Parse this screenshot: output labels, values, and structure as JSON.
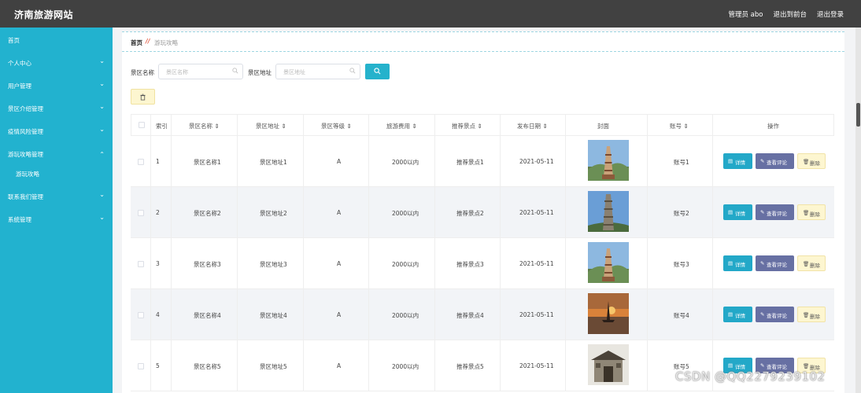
{
  "app": {
    "title": "济南旅游网站",
    "user_label": "管理员 abo",
    "front_link": "退出到前台",
    "logout": "退出登录"
  },
  "sidebar": {
    "items": [
      {
        "label": "首页",
        "chevron": ""
      },
      {
        "label": "个人中心",
        "chevron": "down"
      },
      {
        "label": "用户管理",
        "chevron": "down"
      },
      {
        "label": "景区介绍管理",
        "chevron": "down"
      },
      {
        "label": "疫情风险管理",
        "chevron": "down"
      },
      {
        "label": "游玩攻略管理",
        "chevron": "up"
      },
      {
        "label": "游玩攻略",
        "chevron": "",
        "sub": true
      },
      {
        "label": "联系我们管理",
        "chevron": "down"
      },
      {
        "label": "系统管理",
        "chevron": "down"
      }
    ]
  },
  "breadcrumb": {
    "home": "首页",
    "separator": "//",
    "current": "游玩攻略"
  },
  "filters": {
    "name_label": "景区名称",
    "name_placeholder": "景区名称",
    "address_label": "景区地址",
    "address_placeholder": "景区地址"
  },
  "table": {
    "columns": [
      "索引",
      "景区名称",
      "景区地址",
      "景区等级",
      "旅游费用",
      "推荐景点",
      "发布日期",
      "封面",
      "账号",
      "操作"
    ],
    "rows": [
      {
        "index": "1",
        "name": "景区名称1",
        "address": "景区地址1",
        "level": "A",
        "cost": "2000以内",
        "spot": "推荐景点1",
        "date": "2021-05-11",
        "cover": "pagoda",
        "account": "账号1"
      },
      {
        "index": "2",
        "name": "景区名称2",
        "address": "景区地址2",
        "level": "A",
        "cost": "2000以内",
        "spot": "推荐景点2",
        "date": "2021-05-11",
        "cover": "tower",
        "account": "账号2"
      },
      {
        "index": "3",
        "name": "景区名称3",
        "address": "景区地址3",
        "level": "A",
        "cost": "2000以内",
        "spot": "推荐景点3",
        "date": "2021-05-11",
        "cover": "pagoda",
        "account": "账号3"
      },
      {
        "index": "4",
        "name": "景区名称4",
        "address": "景区地址4",
        "level": "A",
        "cost": "2000以内",
        "spot": "推荐景点4",
        "date": "2021-05-11",
        "cover": "sailboat",
        "account": "账号4"
      },
      {
        "index": "5",
        "name": "景区名称5",
        "address": "景区地址5",
        "level": "A",
        "cost": "2000以内",
        "spot": "推荐景点5",
        "date": "2021-05-11",
        "cover": "gate",
        "account": "账号5"
      }
    ],
    "actions": {
      "detail": "详情",
      "comment": "查看评论",
      "delete": "删除"
    }
  },
  "watermark": "CSDN @QQ2279239102",
  "colors": {
    "topbar": "#414141",
    "sidebar": "#22b2cf",
    "accent": "#25b2cc",
    "comment_button": "#6770a3",
    "delete_button": "#fdf6d0"
  }
}
